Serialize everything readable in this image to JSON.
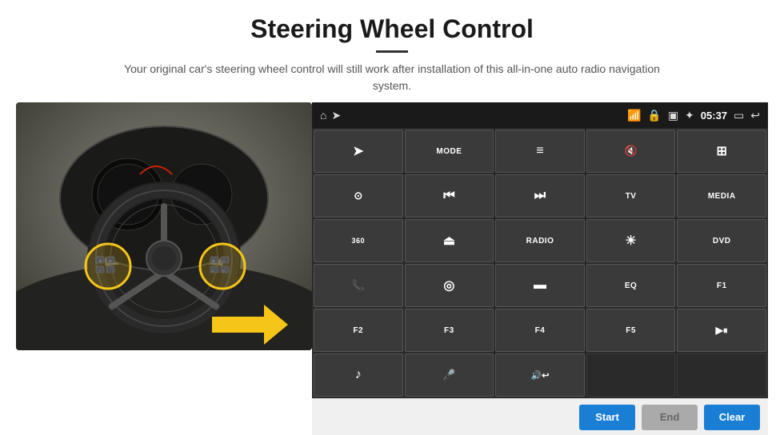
{
  "header": {
    "title": "Steering Wheel Control",
    "subtitle": "Your original car's steering wheel control will still work after installation of this all-in-one auto radio navigation system."
  },
  "topbar": {
    "time": "05:37",
    "icons": [
      "home",
      "wifi",
      "lock",
      "sd",
      "bluetooth",
      "cast",
      "back"
    ]
  },
  "panel_rows": [
    [
      {
        "type": "icon",
        "icon": "▷",
        "label": ""
      },
      {
        "type": "text",
        "label": "MODE"
      },
      {
        "type": "icon",
        "icon": "≡",
        "label": ""
      },
      {
        "type": "icon",
        "icon": "🔇",
        "label": ""
      },
      {
        "type": "icon",
        "icon": "⊞",
        "label": ""
      }
    ],
    [
      {
        "type": "icon",
        "icon": "⊙",
        "label": ""
      },
      {
        "type": "icon",
        "icon": "⏮",
        "label": ""
      },
      {
        "type": "icon",
        "icon": "⏭",
        "label": ""
      },
      {
        "type": "text",
        "label": "TV"
      },
      {
        "type": "text",
        "label": "MEDIA"
      }
    ],
    [
      {
        "type": "icon",
        "icon": "360",
        "label": ""
      },
      {
        "type": "icon",
        "icon": "▲",
        "label": ""
      },
      {
        "type": "text",
        "label": "RADIO"
      },
      {
        "type": "icon",
        "icon": "☀",
        "label": ""
      },
      {
        "type": "text",
        "label": "DVD"
      }
    ],
    [
      {
        "type": "icon",
        "icon": "📞",
        "label": ""
      },
      {
        "type": "icon",
        "icon": "◎",
        "label": ""
      },
      {
        "type": "icon",
        "icon": "▬",
        "label": ""
      },
      {
        "type": "text",
        "label": "EQ"
      },
      {
        "type": "text",
        "label": "F1"
      }
    ],
    [
      {
        "type": "text",
        "label": "F2"
      },
      {
        "type": "text",
        "label": "F3"
      },
      {
        "type": "text",
        "label": "F4"
      },
      {
        "type": "text",
        "label": "F5"
      },
      {
        "type": "icon",
        "icon": "▶⏸",
        "label": ""
      }
    ],
    [
      {
        "type": "icon",
        "icon": "♪",
        "label": ""
      },
      {
        "type": "icon",
        "icon": "🎤",
        "label": ""
      },
      {
        "type": "icon",
        "icon": "🔊/↩",
        "label": ""
      },
      {
        "type": "empty",
        "label": ""
      },
      {
        "type": "empty",
        "label": ""
      }
    ]
  ],
  "bottom_bar": {
    "start_label": "Start",
    "end_label": "End",
    "clear_label": "Clear"
  }
}
